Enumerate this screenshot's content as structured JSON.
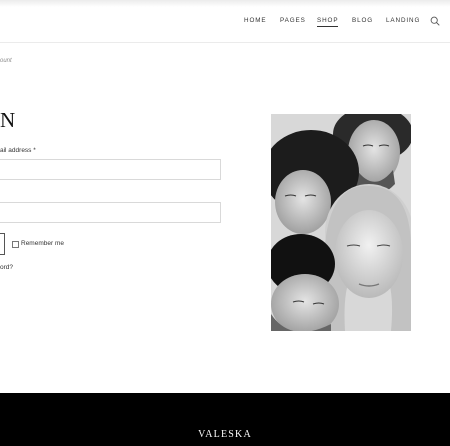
{
  "nav": {
    "items": [
      "HOME",
      "PAGES",
      "SHOP",
      "BLOG",
      "LANDING"
    ],
    "active": "SHOP"
  },
  "icons": {
    "search": "search-icon"
  },
  "breadcrumb": "ount",
  "login": {
    "title": "N",
    "username_label": "ail address *",
    "username_value": "",
    "password_value": "",
    "remember_label": "Remember me",
    "lost_password": "ord?"
  },
  "footer": {
    "logo": "VALESKA"
  },
  "colors": {
    "footer_bg": "#000000",
    "text": "#222222",
    "border": "#d9d9d9"
  }
}
